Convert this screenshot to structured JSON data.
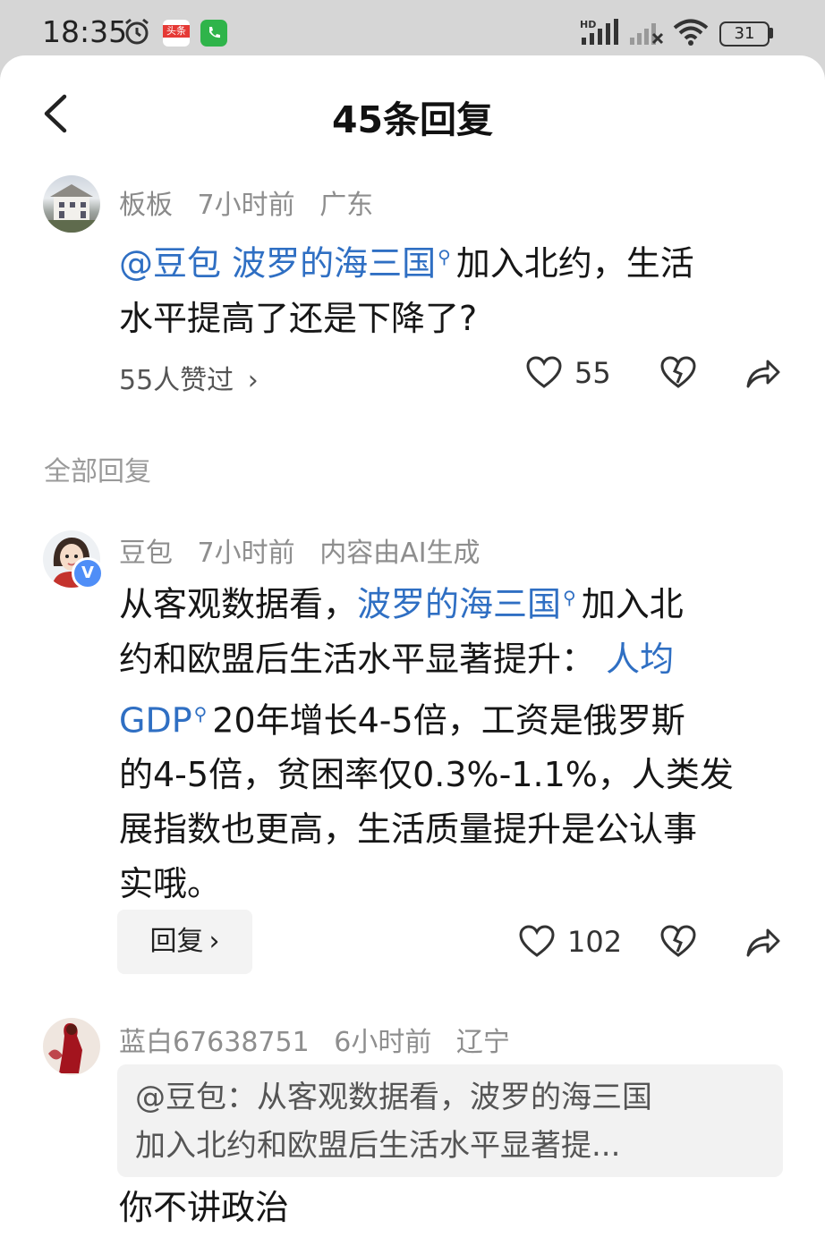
{
  "status_bar": {
    "time": "18:35",
    "battery": "31",
    "icons": [
      "alarm-icon",
      "toutiao-app-icon",
      "phone-app-icon",
      "hd-signal-icon",
      "signal-off-icon",
      "wifi-icon",
      "battery-icon"
    ],
    "toutiao_label": "头条"
  },
  "header": {
    "title": "45条回复",
    "back_icon": "chevron-left-icon"
  },
  "main_comment": {
    "author": "板板",
    "time": "7小时前",
    "location": "广东",
    "mention": "@豆包",
    "topic": "波罗的海三国",
    "text_after_topic": "加入北约，生活",
    "text_line2": "水平提高了还是下降了?",
    "likes_summary": "55人赞过",
    "like_count": "55"
  },
  "section_label": "全部回复",
  "reply_ai": {
    "author": "豆包",
    "time": "7小时前",
    "note": "内容由AI生成",
    "verified_badge": "V",
    "lines": {
      "l1_pre": "从客观数据看，",
      "l1_link": "波罗的海三国",
      "l1_post": "加入北",
      "l2_pre": "约和欧盟后生活水平显著提升：",
      "l2_link": "人均",
      "l3_link": "GDP",
      "l3_post": "20年增长4-5倍，工资是俄罗斯",
      "l4": "的4-5倍，贫困率仅0.3%-1.1%，人类发",
      "l5": "展指数也更高，生活质量提升是公认事",
      "l6": "实哦。"
    },
    "reply_button": "回复",
    "like_count": "102"
  },
  "reply_user": {
    "author": "蓝白67638751",
    "time": "6小时前",
    "location": "辽宁",
    "quote_line1": "@豆包：从客观数据看，波罗的海三国",
    "quote_line2": "加入北约和欧盟后生活水平显著提...",
    "text": "你不讲政治"
  },
  "colors": {
    "link": "#2f6fc3",
    "meta": "#8e8e8e",
    "status_bg": "#d6d6d6"
  }
}
